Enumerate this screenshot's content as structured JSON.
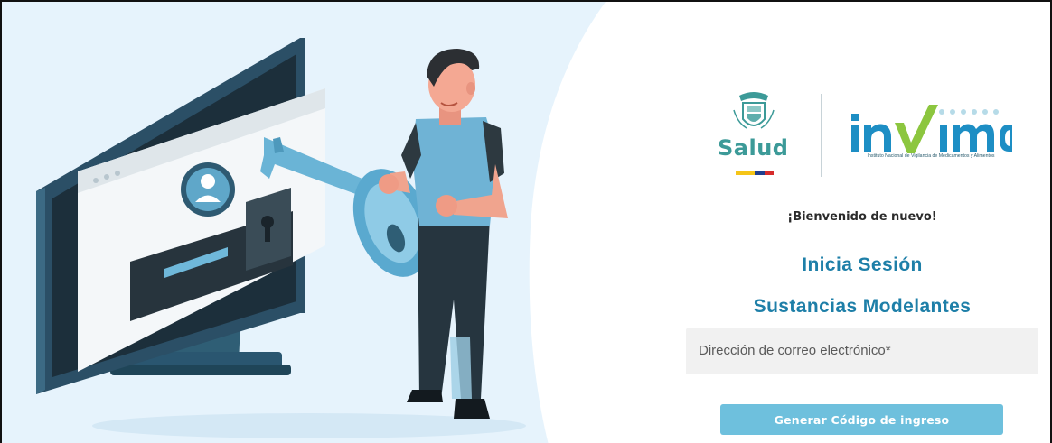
{
  "logos": {
    "salud_text": "Salud",
    "invima_tagline": "Instituto Nacional de Vigilancia de Medicamentos y Alimentos"
  },
  "login": {
    "welcome": "¡Bienvenido de nuevo!",
    "title": "Inicia Sesión",
    "subtitle": "Sustancias Modelantes",
    "email_placeholder": "Dirección de correo electrónico*",
    "email_value": "",
    "submit_label": "Generar Código de ingreso"
  },
  "colors": {
    "accent_title": "#1e7fa8",
    "button": "#6ec0dd",
    "illustration_bg": "#e6f3fc",
    "salud_green": "#3c9a98"
  },
  "icons": {
    "illustration": "person-with-key-monitor-illustration",
    "coat_of_arms": "colombia-coat-of-arms-icon"
  }
}
